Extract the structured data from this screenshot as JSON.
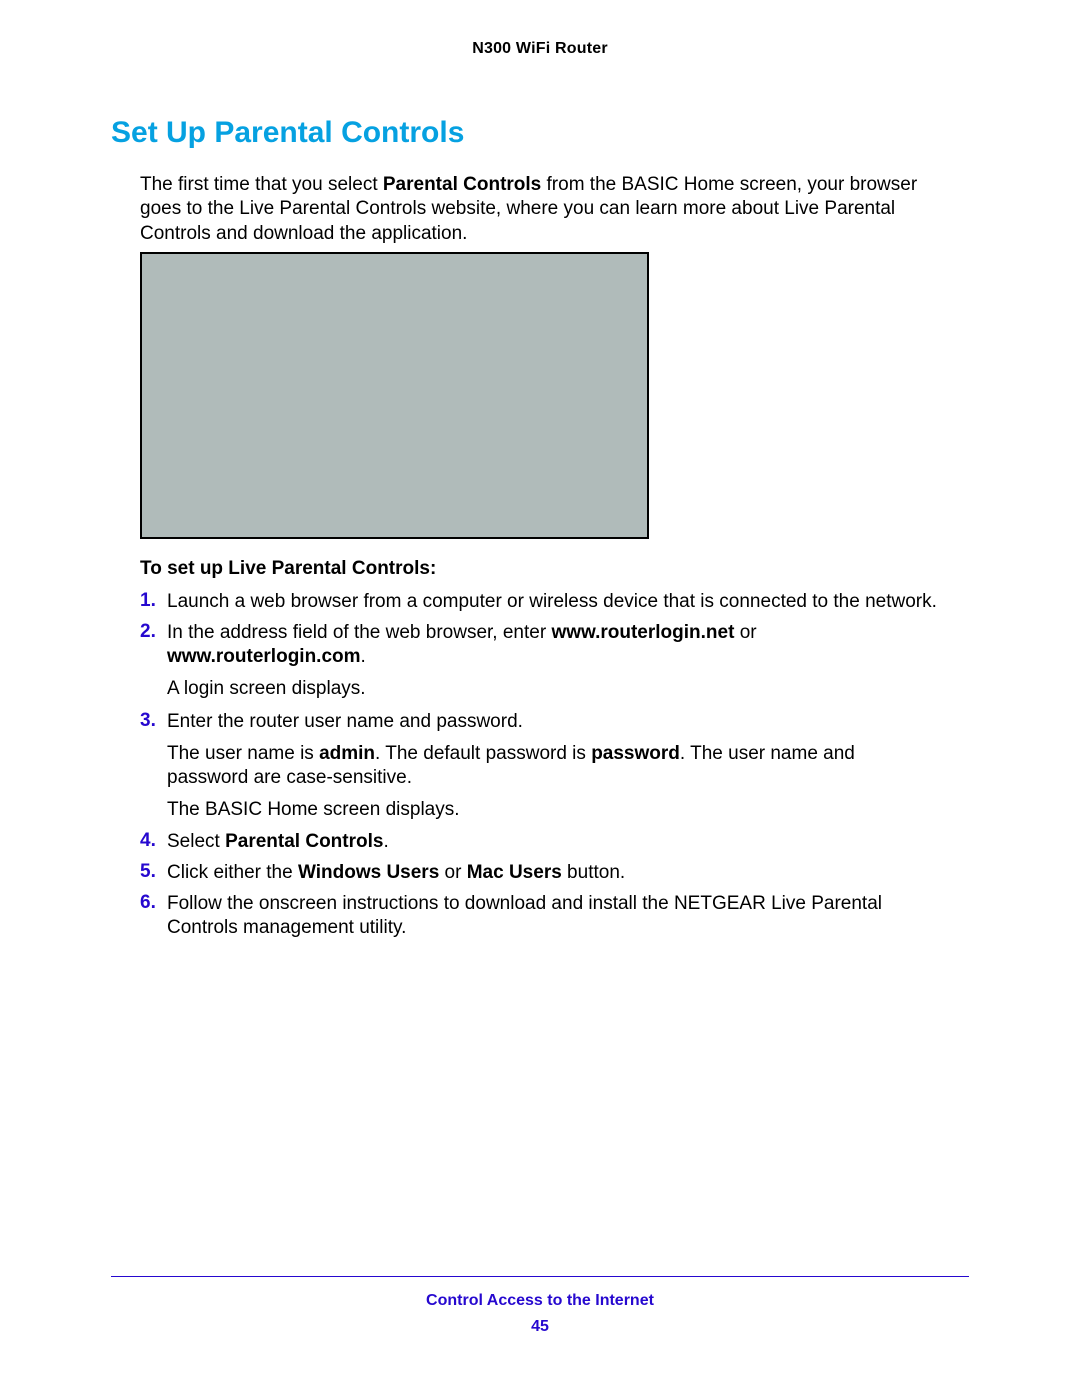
{
  "header": {
    "title": "N300 WiFi Router"
  },
  "section": {
    "heading": "Set Up Parental Controls"
  },
  "intro": {
    "part1": "The first time that you select ",
    "bold1": "Parental Controls",
    "part2": " from the BASIC Home screen, your browser goes to the Live Parental Controls website, where you can learn more about Live Parental Controls and download the application."
  },
  "procedure": {
    "heading": "To set up Live Parental Controls:"
  },
  "steps": {
    "s1": {
      "num": "1.",
      "text": "Launch a web browser from a computer or wireless device that is connected to the network."
    },
    "s2": {
      "num": "2.",
      "part1": "In the address field of the web browser, enter ",
      "bold1": "www.routerlogin.net",
      "part2": " or ",
      "bold2": "www.routerlogin.com",
      "part3": ".",
      "sub1": "A login screen displays."
    },
    "s3": {
      "num": "3.",
      "text": "Enter the router user name and password.",
      "sub1_part1": "The user name is ",
      "sub1_bold1": "admin",
      "sub1_part2": ". The default password is ",
      "sub1_bold2": "password",
      "sub1_part3": ". The user name and password are case-sensitive.",
      "sub2": "The BASIC Home screen displays."
    },
    "s4": {
      "num": "4.",
      "part1": "Select ",
      "bold1": "Parental Controls",
      "part2": "."
    },
    "s5": {
      "num": "5.",
      "part1": "Click either the ",
      "bold1": "Windows Users",
      "part2": " or ",
      "bold2": "Mac Users",
      "part3": " button."
    },
    "s6": {
      "num": "6.",
      "text": "Follow the onscreen instructions to download and install the NETGEAR Live Parental Controls management utility."
    }
  },
  "footer": {
    "section": "Control Access to the Internet",
    "page": "45"
  }
}
